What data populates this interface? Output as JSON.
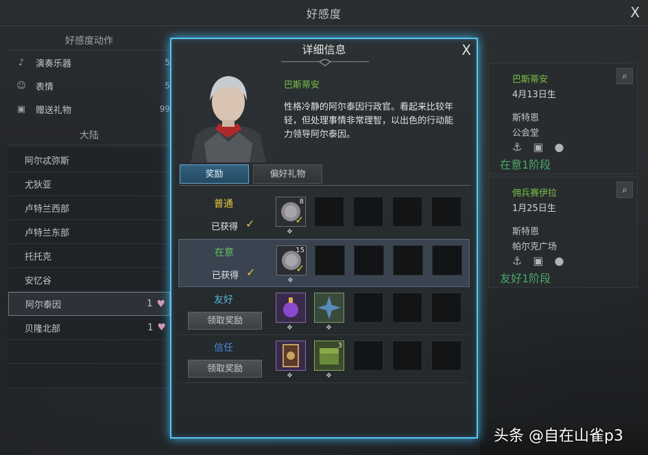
{
  "window": {
    "title": "好感度",
    "close": "X"
  },
  "left": {
    "actions_header": "好感度动作",
    "actions": [
      {
        "label": "演奏乐器",
        "count": "5",
        "icon": "music-note-icon"
      },
      {
        "label": "表情",
        "count": "5",
        "icon": "emote-icon"
      },
      {
        "label": "赠送礼物",
        "count": "99",
        "icon": "gift-icon"
      }
    ],
    "regions_header": "大陆",
    "regions": [
      {
        "label": "阿尔忒弥斯",
        "level": ""
      },
      {
        "label": "尤狄亚",
        "level": ""
      },
      {
        "label": "卢特兰西部",
        "level": ""
      },
      {
        "label": "卢特兰东部",
        "level": ""
      },
      {
        "label": "托托克",
        "level": ""
      },
      {
        "label": "安忆谷",
        "level": ""
      },
      {
        "label": "阿尔泰因",
        "level": "1"
      },
      {
        "label": "贝隆北部",
        "level": "1"
      }
    ]
  },
  "npcs": [
    {
      "name": "巴斯蒂安",
      "birthday": "4月13日生",
      "place1": "斯特恩",
      "place2": "公会堂",
      "stage": "在意1阶段"
    },
    {
      "name": "佣兵赛伊拉",
      "birthday": "1月25日生",
      "place1": "斯特恩",
      "place2": "帕尔克广场",
      "stage": "友好1阶段"
    }
  ],
  "dialog": {
    "title": "详细信息",
    "close": "X",
    "char_name": "巴斯蒂安",
    "char_desc": "性格冷静的阿尔泰因行政官。看起来比较年轻，但处理事情非常理智，以出色的行动能力领导阿尔泰因。",
    "tabs": [
      "奖励",
      "偏好礼物"
    ],
    "rows": [
      {
        "tier": "普通",
        "tier_color": "#e8c840",
        "status": "已获得",
        "claim": "",
        "qty": "8"
      },
      {
        "tier": "在意",
        "tier_color": "#62c062",
        "status": "已获得",
        "claim": "",
        "qty": "15"
      },
      {
        "tier": "友好",
        "tier_color": "#56b8d8",
        "status": "",
        "claim": "领取奖励",
        "qty": ""
      },
      {
        "tier": "信任",
        "tier_color": "#4a8ee0",
        "status": "",
        "claim": "领取奖励",
        "qty": "3"
      }
    ]
  },
  "watermark": "头条 @自在山雀p3"
}
